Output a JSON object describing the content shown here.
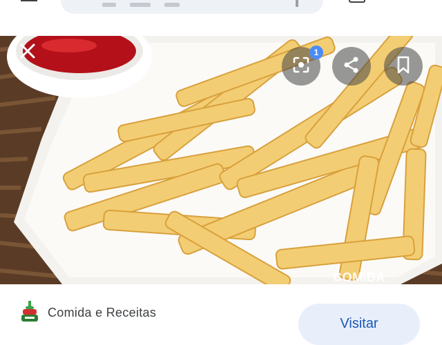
{
  "header": {
    "menu_icon": "hamburger-icon",
    "tab_icon": "tabs-icon"
  },
  "viewer": {
    "close_icon": "close-icon",
    "lens_icon": "google-lens-icon",
    "lens_badge": "1",
    "share_icon": "share-icon",
    "save_icon": "bookmark-icon",
    "watermark": "COMIDA"
  },
  "source": {
    "name": "Comida e Receitas",
    "visit_label": "Visitar",
    "logo_icon": "recipe-site-logo-icon"
  }
}
